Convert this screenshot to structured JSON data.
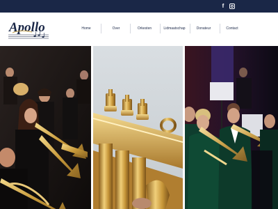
{
  "topbar": {
    "background": "#1a2747",
    "social": [
      {
        "name": "facebook",
        "icon": "facebook-icon",
        "glyph": "f"
      },
      {
        "name": "instagram",
        "icon": "instagram-icon"
      }
    ]
  },
  "brand": {
    "logo_text": "Apollo",
    "colors": {
      "navy": "#1a2747",
      "gold": "#c9a24a"
    }
  },
  "nav": {
    "items": [
      {
        "label": "Home"
      },
      {
        "label": "Over"
      },
      {
        "label": "Orkesten"
      },
      {
        "label": "Lidmaatschap"
      },
      {
        "label": "Donateur"
      },
      {
        "label": "Contact"
      }
    ]
  },
  "gallery": {
    "photos": [
      {
        "subject": "brass-band-playing-trumpets"
      },
      {
        "subject": "trumpet-valves-close-up"
      },
      {
        "subject": "musicians-in-green-uniforms"
      }
    ]
  }
}
